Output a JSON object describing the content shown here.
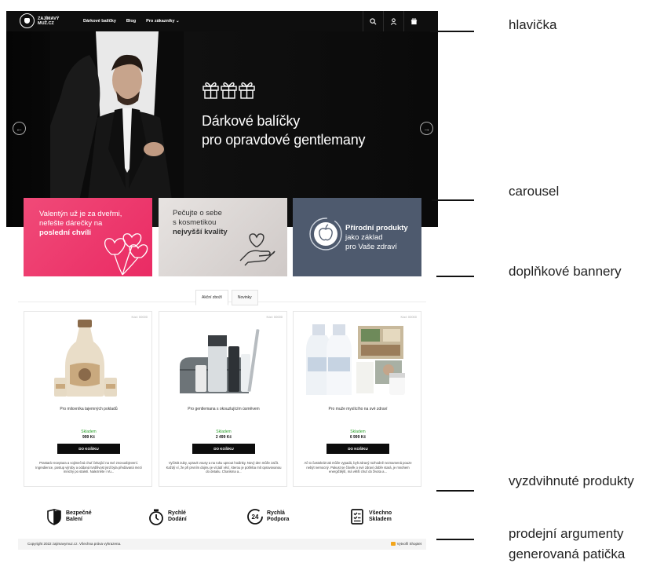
{
  "header": {
    "logo_text": "ZAJÍMAVÝ MUŽ.CZ",
    "nav": [
      "Dárkové balíčky",
      "Blog",
      "Pro zákazníky ⌄"
    ],
    "icons": [
      "search-icon",
      "user-icon",
      "gift-icon"
    ]
  },
  "carousel": {
    "title_line1": "Dárkové balíčky",
    "title_line2": "pro opravdové gentlemany"
  },
  "banners": [
    {
      "line1": "Valentýn už je za dveřmi,",
      "line2": "nefešte dárečky na",
      "line3": "poslední chvíli"
    },
    {
      "line1": "Pečujte o sebe",
      "line2": "s kosmetikou",
      "line3": "nejvyšší kvality"
    },
    {
      "line1": "Přírodní produkty",
      "line2": "jako základ",
      "line3": "pro Vaše zdraví"
    }
  ],
  "tabs": [
    "Akční zboží",
    "Novinky"
  ],
  "products": [
    {
      "corner": "Kód: 00000",
      "name": "Pro milovníka tajemných pokladů",
      "stock": "Skladem",
      "price": "999 Kč",
      "cart": "DO KOŠÍKU",
      "desc": "Prastará receptura a vojimečná chuť čekající na své znovuobjevení. Ingredience, postup výroby a oddaná tvrdílivost jsrd byla předávaná mezi mnichy po staletí. Nalezněte i Vu..."
    },
    {
      "corner": "Kód: 00000",
      "name": "Pro gentlemana s okouzlujícím úsměvem",
      "stock": "Skladem",
      "price": "2 499 Kč",
      "cart": "DO KOŠÍKU",
      "desc": "Vyčistit zuby, upravit vousy a na ruku upnout hodinky. Nový den může začít. Každý ví, že při prvním dojmu je vícádí věcí, kterou je potřeba mít opravovanou do detailu. Charisma a..."
    },
    {
      "corner": "Kód: 00000",
      "name": "Pro muže myslícího na své zdraví",
      "stock": "Skladem",
      "price": "6 999 Kč",
      "cart": "DO KOŠÍKU",
      "desc": "Ač to častokrát tak může vypadá, bylt zdravý rozhodně neznamená pouze nebýt nemocný. Pakust se člověk o své zdraví dobře stará, je mnohem energičtější, má větší chuť do života a..."
    }
  ],
  "arguments": [
    {
      "icon": "shield-icon",
      "line1": "Bezpečné",
      "line2": "Balení"
    },
    {
      "icon": "stopwatch-icon",
      "line1": "Rychlé",
      "line2": "Dodání"
    },
    {
      "icon": "support-24-icon",
      "line1": "Rychlá",
      "line2": "Podpora"
    },
    {
      "icon": "checklist-icon",
      "line1": "Všechno",
      "line2": "Skladem"
    }
  ],
  "footer": {
    "copyright": "Copyright 2022 zajimavymuz.cz. Všechna práva vyhrazena.",
    "shoptet": "Vytvořil Shoptet"
  },
  "annotations": [
    "hlavička",
    "carousel",
    "doplňkové bannery",
    "vyzdvihnuté produkty",
    "prodejní argumenty",
    "generovaná patička"
  ]
}
